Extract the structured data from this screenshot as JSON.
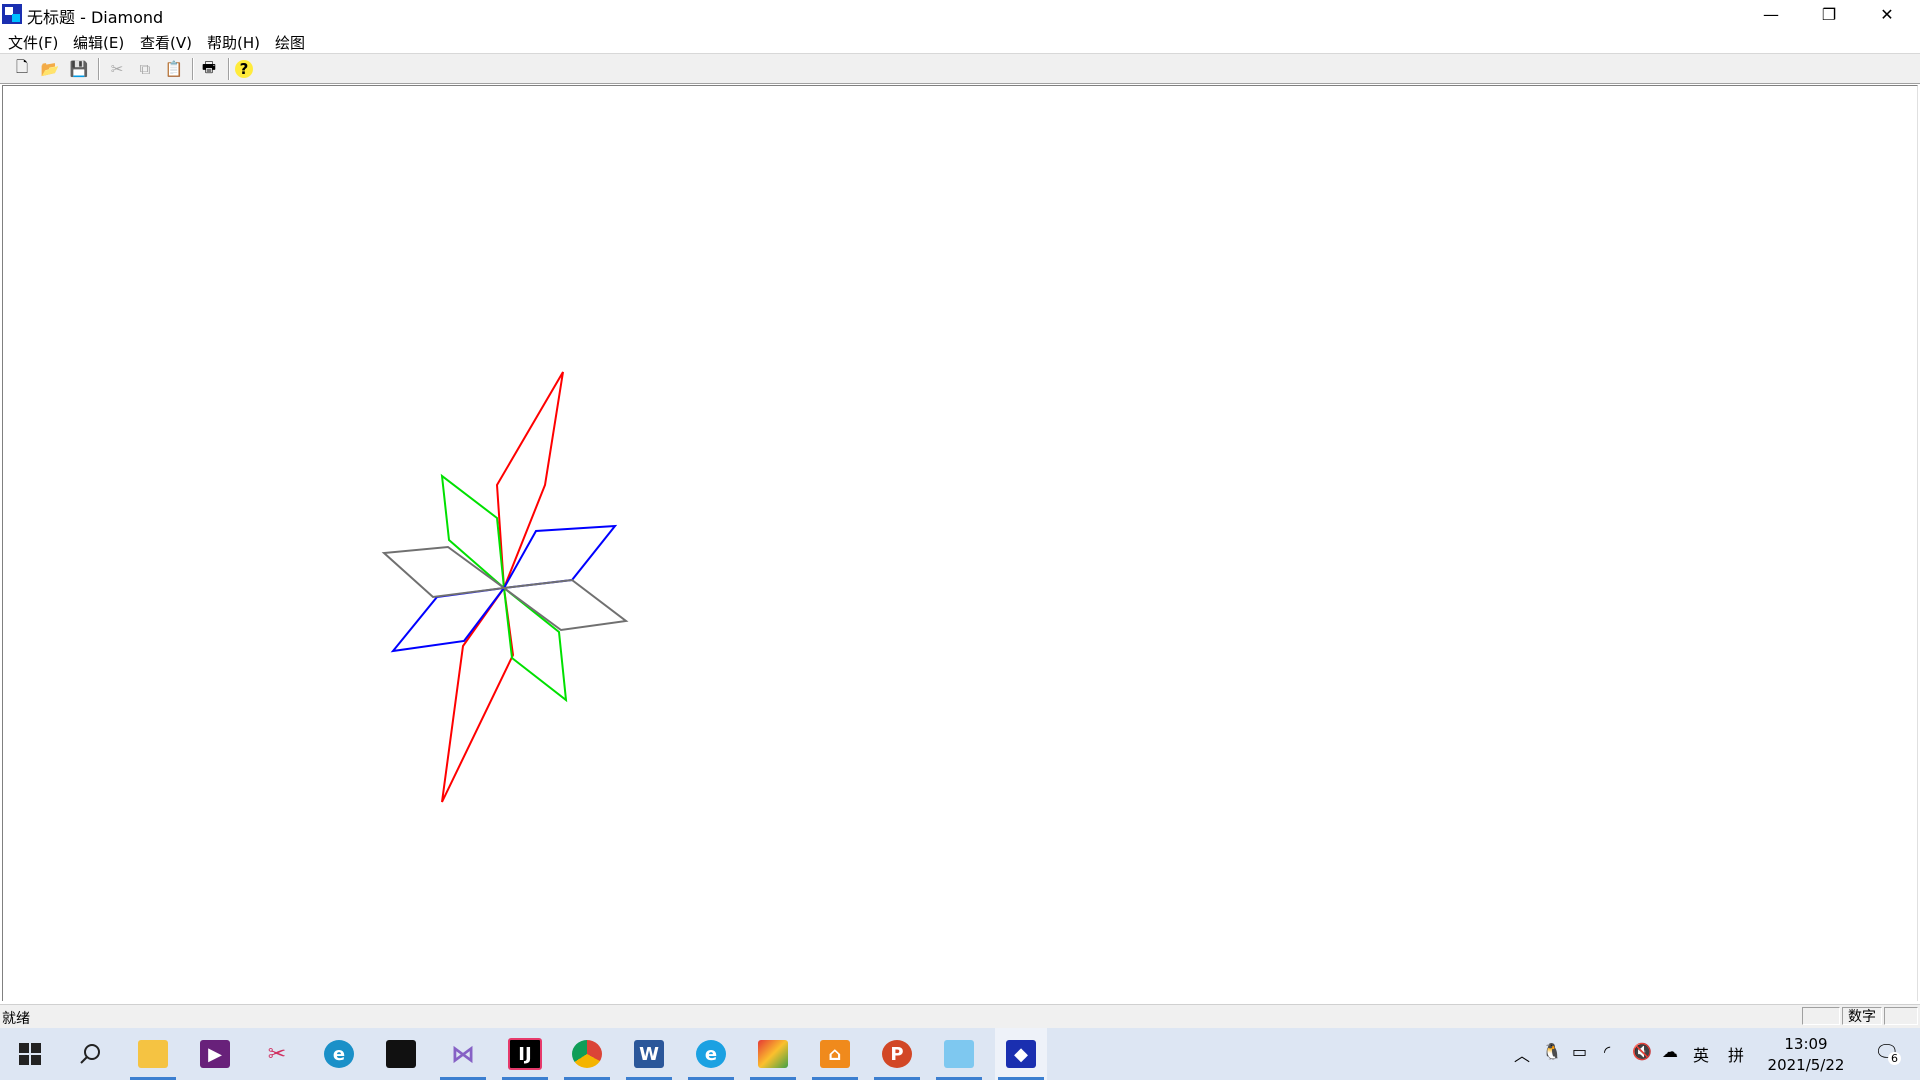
{
  "window": {
    "title": "无标题 - Diamond",
    "app_icon": "diamond-app-icon",
    "controls": {
      "minimize": "—",
      "restore": "❐",
      "close": "✕"
    }
  },
  "menu": {
    "items": [
      "文件(F)",
      "编辑(E)",
      "查看(V)",
      "帮助(H)",
      "绘图"
    ]
  },
  "toolbar": {
    "buttons": [
      {
        "name": "new-icon",
        "glyph": "🗋",
        "enabled": true
      },
      {
        "name": "open-icon",
        "glyph": "📂",
        "enabled": true
      },
      {
        "name": "save-icon",
        "glyph": "💾",
        "enabled": true
      },
      {
        "name": "cut-icon",
        "glyph": "✂",
        "enabled": false
      },
      {
        "name": "copy-icon",
        "glyph": "⧉",
        "enabled": false
      },
      {
        "name": "paste-icon",
        "glyph": "📋",
        "enabled": false
      },
      {
        "name": "print-icon",
        "glyph": "🖶",
        "enabled": true
      },
      {
        "name": "help-icon",
        "glyph": "?",
        "enabled": true
      }
    ]
  },
  "canvas": {
    "drawing": "diamond-star",
    "colors": {
      "red": "#ff0000",
      "green": "#00e000",
      "blue": "#0000ff",
      "gray": "#707070"
    }
  },
  "statusbar": {
    "text": "就绪",
    "panes": [
      "",
      "数字",
      ""
    ]
  },
  "taskbar": {
    "apps": [
      {
        "name": "start-icon"
      },
      {
        "name": "search-icon"
      },
      {
        "name": "file-explorer-icon"
      },
      {
        "name": "visual-studio-preview-icon"
      },
      {
        "name": "snipping-tool-icon"
      },
      {
        "name": "edge-icon"
      },
      {
        "name": "terminal-icon"
      },
      {
        "name": "visual-studio-icon"
      },
      {
        "name": "jetbrains-icon"
      },
      {
        "name": "chrome-icon"
      },
      {
        "name": "word-icon"
      },
      {
        "name": "ie-icon"
      },
      {
        "name": "app-colorful-icon"
      },
      {
        "name": "app-orange-icon"
      },
      {
        "name": "powerpoint-icon"
      },
      {
        "name": "control-panel-icon"
      },
      {
        "name": "diamond-taskbar-icon"
      }
    ],
    "tray": {
      "ime_lang": "英",
      "ime_mode": "拼",
      "time": "13:09",
      "date": "2021/5/22",
      "notification_count": "6"
    }
  }
}
